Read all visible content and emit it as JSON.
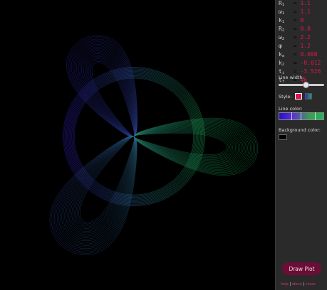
{
  "params": [
    {
      "sym": "R",
      "sub": "1",
      "value": "1.1"
    },
    {
      "sym": "ω",
      "sub": "1",
      "value": "1.1"
    },
    {
      "sym": "k",
      "sub": "1",
      "value": "0"
    },
    {
      "sym": "R",
      "sub": "2",
      "value": "0.8"
    },
    {
      "sym": "ω",
      "sub": "2",
      "value": "2.2"
    },
    {
      "sym": "φ",
      "sub": "",
      "value": "1.2"
    },
    {
      "sym": "k",
      "sub": "a",
      "value": "0.008"
    },
    {
      "sym": "k",
      "sub": "2",
      "value": "-0.012"
    },
    {
      "sym": "t",
      "sub": "i",
      "value": "-3.526"
    },
    {
      "sym": "t",
      "sub": "f",
      "value": "46"
    }
  ],
  "labels": {
    "line_width": "Line width:",
    "style": "Style:",
    "line_color": "Line color:",
    "background_color": "Background color:"
  },
  "line_width_level": 0.6,
  "style_options": [
    "solid",
    "gradient"
  ],
  "colors": {
    "solid_style": "#e0154a",
    "gradient_start": "#3a1fd0",
    "gradient_end": "#1fb55a",
    "background": "#000000",
    "panel": "#2a2a2a"
  },
  "draw_button": "Draw Plot",
  "links": [
    "help",
    "about",
    "share"
  ]
}
